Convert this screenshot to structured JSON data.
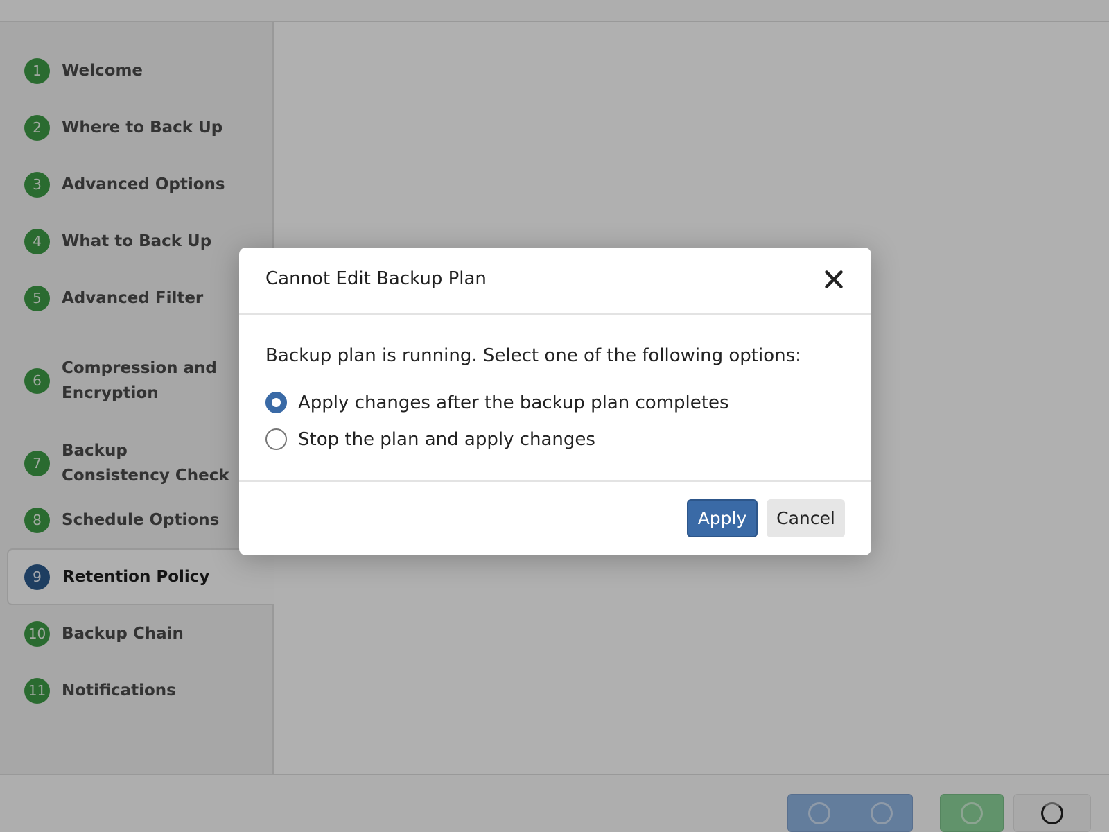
{
  "sidebar": {
    "steps": [
      {
        "number": "1",
        "label": "Welcome",
        "state": "complete"
      },
      {
        "number": "2",
        "label": "Where to Back Up",
        "state": "complete"
      },
      {
        "number": "3",
        "label": "Advanced Options",
        "state": "complete"
      },
      {
        "number": "4",
        "label": "What to Back Up",
        "state": "complete"
      },
      {
        "number": "5",
        "label": "Advanced Filter",
        "state": "complete"
      },
      {
        "number": "6",
        "label": "Compression and Encryption",
        "state": "complete"
      },
      {
        "number": "7",
        "label": "Backup Consistency Check",
        "state": "complete"
      },
      {
        "number": "8",
        "label": "Schedule Options",
        "state": "complete"
      },
      {
        "number": "9",
        "label": "Retention Policy",
        "state": "active"
      },
      {
        "number": "10",
        "label": "Backup Chain",
        "state": "complete"
      },
      {
        "number": "11",
        "label": "Notifications",
        "state": "complete"
      }
    ]
  },
  "colors": {
    "step_complete": "#3d9a45",
    "step_active": "#2c5a8c",
    "primary": "#3a6aa6"
  },
  "footer": {
    "buttons": [
      {
        "name": "back",
        "icon": "loading-spinner-icon"
      },
      {
        "name": "next",
        "icon": "loading-spinner-icon"
      },
      {
        "name": "save",
        "icon": "loading-spinner-icon"
      },
      {
        "name": "cancel",
        "icon": "loading-spinner-icon"
      }
    ]
  },
  "dialog": {
    "title": "Cannot Edit Backup Plan",
    "close_icon": "close-icon",
    "prompt": "Backup plan is running. Select one of the following options:",
    "options": [
      {
        "label": "Apply changes after the backup plan completes",
        "selected": true
      },
      {
        "label": "Stop the plan and apply changes",
        "selected": false
      }
    ],
    "apply_label": "Apply",
    "cancel_label": "Cancel"
  }
}
